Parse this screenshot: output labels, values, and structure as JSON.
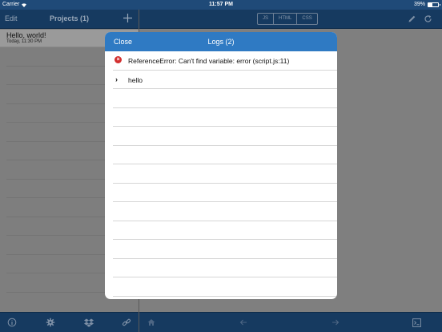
{
  "status_bar": {
    "carrier": "Carrier",
    "time": "11:57 PM",
    "battery_text": "39%",
    "battery_level": 0.39
  },
  "sidebar": {
    "edit_label": "Edit",
    "title": "Projects (1)",
    "add_icon": "plus-icon",
    "projects": [
      {
        "name": "Hello, world!",
        "date": "Today, 11:30 PM"
      }
    ],
    "toolbar_icons": [
      "info-icon",
      "gear-icon",
      "dropbox-icon",
      "link-icon"
    ]
  },
  "editor": {
    "tabs": [
      "JS",
      "HTML",
      "CSS"
    ],
    "nav_icons": [
      "pencil-icon",
      "refresh-icon"
    ],
    "toolbar_icons": [
      "home-icon",
      "back-arrow-icon",
      "forward-arrow-icon",
      "console-icon"
    ]
  },
  "logs_modal": {
    "close_label": "Close",
    "title": "Logs (2)",
    "entries": [
      {
        "type": "error",
        "icon": "error-icon",
        "text": "ReferenceError: Can't find variable: error (script.js:11)"
      },
      {
        "type": "log",
        "icon": "chevron-right-icon",
        "text": "hello"
      }
    ]
  },
  "colors": {
    "nav_bg": "#163a60",
    "modal_header": "#2f7ac3",
    "error_red": "#d32f2f"
  }
}
